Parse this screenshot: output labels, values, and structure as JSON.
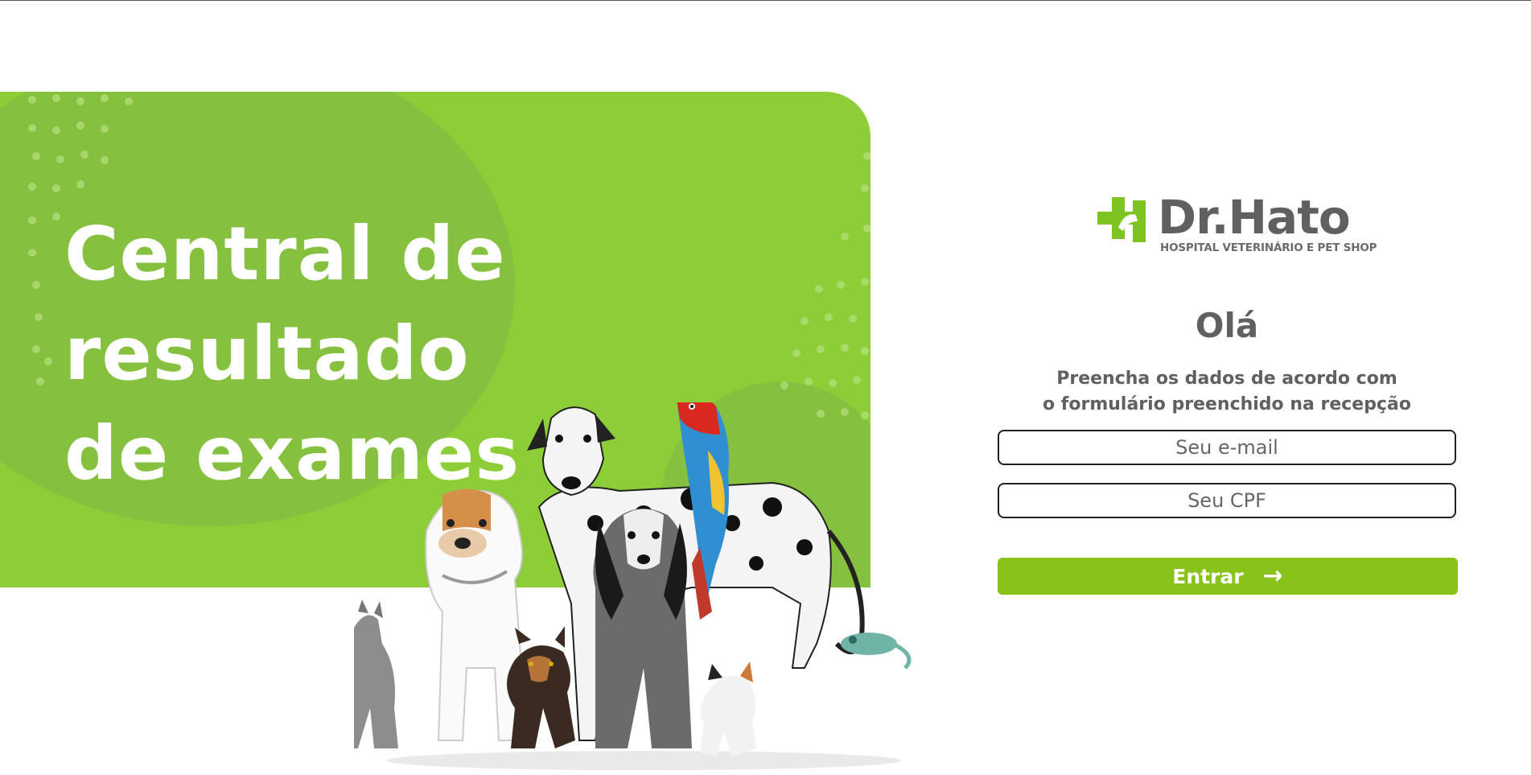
{
  "hero": {
    "title_lines": [
      "Central de",
      "resultado",
      "de exames"
    ],
    "panel_color": "#8ccd38"
  },
  "brand": {
    "name": "Dr.Hato",
    "tagline": "HOSPITAL VETERINÁRIO E PET SHOP",
    "accent": "#7dc423",
    "text_color": "#5f6062"
  },
  "login": {
    "greeting": "Olá",
    "instruction_lines": [
      "Preencha os dados de acordo com",
      "o formulário preenchido na recepção"
    ],
    "email_placeholder": "Seu e-mail",
    "cpf_placeholder": "Seu CPF",
    "submit_label": "Entrar",
    "submit_icon": "arrow-right-icon",
    "button_color": "#8ac21c"
  },
  "illustration": {
    "icon": "pets-group-illustration"
  }
}
